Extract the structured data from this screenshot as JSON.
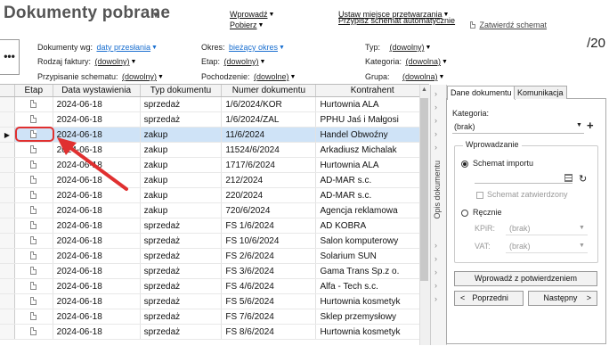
{
  "header": {
    "title": "Dokumenty pobrane",
    "menu": {
      "wprowadz": "Wprowadź",
      "pobierz": "Pobierz",
      "ustaw_miejsce": "Ustaw miejsce przetwarzania",
      "przypisz_schemat": "Przypisz schemat automatycznie",
      "zatwierdz_schemat": "Zatwierdź schemat"
    },
    "more": "•••",
    "page_count": "/20"
  },
  "filters": {
    "dokumenty_wg": {
      "label": "Dokumenty wg:",
      "value": "daty przesłania"
    },
    "rodzaj_faktury": {
      "label": "Rodzaj faktury:",
      "value": "(dowolny)"
    },
    "przypisanie_schematu": {
      "label": "Przypisanie schematu:",
      "value": "(dowolny)"
    },
    "okres": {
      "label": "Okres:",
      "value": "bieżący okres"
    },
    "etap": {
      "label": "Etap:",
      "value": "(dowolny)"
    },
    "pochodzenie": {
      "label": "Pochodzenie:",
      "value": "(dowolne)"
    },
    "typ": {
      "label": "Typ:",
      "value": "(dowolny)"
    },
    "kategoria": {
      "label": "Kategoria:",
      "value": "(dowolna)"
    },
    "grupa": {
      "label": "Grupa:",
      "value": "(dowolna)"
    }
  },
  "table": {
    "columns": [
      "Etap",
      "Data wystawienia",
      "Typ dokumentu",
      "Numer dokumentu",
      "Kontrahent"
    ],
    "rows": [
      [
        "",
        "2024-06-18",
        "sprzedaż",
        "1/6/2024/KOR",
        "Hurtownia ALA"
      ],
      [
        "",
        "2024-06-18",
        "sprzedaż",
        "1/6/2024/ZAL",
        "PPHU Jaś i Małgosi"
      ],
      [
        "",
        "2024-06-18",
        "zakup",
        "11/6/2024",
        "Handel Obwoźny"
      ],
      [
        "",
        "2024-06-18",
        "zakup",
        "11524/6/2024",
        "Arkadiusz Michalak"
      ],
      [
        "",
        "2024-06-18",
        "zakup",
        "1717/6/2024",
        "Hurtownia ALA"
      ],
      [
        "",
        "2024-06-18",
        "zakup",
        "212/2024",
        "AD-MAR s.c."
      ],
      [
        "",
        "2024-06-18",
        "zakup",
        "220/2024",
        "AD-MAR s.c."
      ],
      [
        "",
        "2024-06-18",
        "zakup",
        "720/6/2024",
        "Agencja reklamowa"
      ],
      [
        "",
        "2024-06-18",
        "sprzedaż",
        "FS 1/6/2024",
        "AD KOBRA"
      ],
      [
        "",
        "2024-06-18",
        "sprzedaż",
        "FS 10/6/2024",
        "Salon komputerowy"
      ],
      [
        "",
        "2024-06-18",
        "sprzedaż",
        "FS 2/6/2024",
        "Solarium SUN"
      ],
      [
        "",
        "2024-06-18",
        "sprzedaż",
        "FS 3/6/2024",
        "Gama Trans Sp.z o."
      ],
      [
        "",
        "2024-06-18",
        "sprzedaż",
        "FS 4/6/2024",
        "Alfa - Tech s.c."
      ],
      [
        "",
        "2024-06-18",
        "sprzedaż",
        "FS 5/6/2024",
        "Hurtownia kosmetyk"
      ],
      [
        "",
        "2024-06-18",
        "sprzedaż",
        "FS 7/6/2024",
        "Sklep przemysłowy"
      ],
      [
        "",
        "2024-06-18",
        "sprzedaż",
        "FS 8/6/2024",
        "Hurtownia kosmetyk"
      ]
    ],
    "selected_row": 2
  },
  "side_strip": {
    "label": "Opis dokumentu"
  },
  "panel": {
    "tabs": [
      "Dane dokumentu",
      "Komunikacja"
    ],
    "kategoria_label": "Kategoria:",
    "kategoria_value": "(brak)",
    "wprowadzanie_label": "Wprowadzanie",
    "schemat_importu": "Schemat importu",
    "schemat_zatwierdzony": "Schemat zatwierdzony",
    "recznie": "Ręcznie",
    "kpir_label": "KPiR:",
    "kpir_value": "(brak)",
    "vat_label": "VAT:",
    "vat_value": "(brak)",
    "wprowadz_btn": "Wprowadź z potwierdzeniem",
    "poprzedni_btn": "Poprzedni",
    "nastepny_btn": "Następny",
    "prev_arrow": "<",
    "next_arrow": ">"
  },
  "colors": {
    "selection": "#cfe3f7",
    "highlight": "#e03030",
    "link_blue": "#1a6fd0"
  }
}
